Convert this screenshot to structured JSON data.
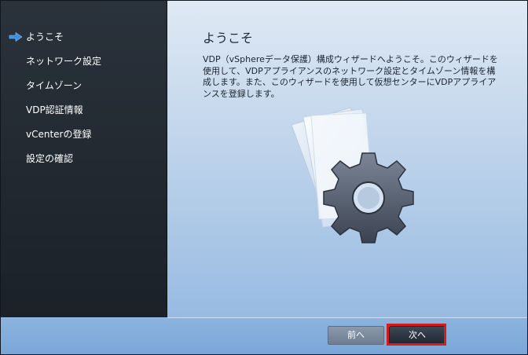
{
  "sidebar": {
    "items": [
      {
        "label": "ようこそ",
        "active": true
      },
      {
        "label": "ネットワーク設定",
        "active": false
      },
      {
        "label": "タイムゾーン",
        "active": false
      },
      {
        "label": "VDP認証情報",
        "active": false
      },
      {
        "label": "vCenterの登録",
        "active": false
      },
      {
        "label": "設定の確認",
        "active": false
      }
    ],
    "active_indicator_icon": "right-arrow-icon",
    "active_indicator_color": "#3a8fe0"
  },
  "main": {
    "title": "ようこそ",
    "description": "VDP（vSphereデータ保護）構成ウィザードへようこそ。このウィザードを使用して、VDPアプライアンスのネットワーク設定とタイムゾーン情報を構成します。また、このウィザードを使用して仮想センターにVDPアプライアンスを登録します。",
    "illustration_icon": "gear-document-icon"
  },
  "footer": {
    "prev_label": "前へ",
    "next_label": "次へ",
    "highlight_color": "#d91a1a"
  }
}
